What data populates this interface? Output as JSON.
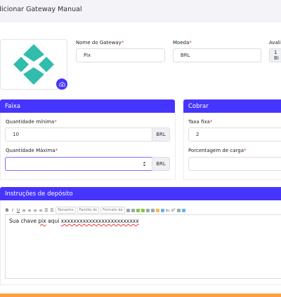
{
  "header": {
    "title": "dicionar Gateway Manual"
  },
  "logo": {
    "alt_name": "pix-logo"
  },
  "fields": {
    "gateway_name": {
      "label": "Nome do Gateway",
      "value": "Pix"
    },
    "currency": {
      "label": "Moeda",
      "value": "BRL"
    },
    "rate": {
      "label": "Avali",
      "value": "1 BI"
    }
  },
  "faixa": {
    "title": "Faixa",
    "min_label": "Quantidade mínima",
    "min_value": "10",
    "min_unit": "BRL",
    "max_label": "Quantidade Máxima",
    "max_value": "",
    "max_unit": "BRL"
  },
  "cobrar": {
    "title": "Cobrar",
    "fixed_label": "Taxa fixa",
    "fixed_value": "2",
    "percent_label": "Porcentagem de carga"
  },
  "instructions": {
    "title": "Instruções de depósito",
    "toolbar": {
      "size": "Tamanho",
      "font": "Família de",
      "format": "Formato da"
    },
    "content_start": "Sua chave ",
    "content_pix": "pix",
    "content_mid": " aqui ",
    "content_key": "xxxxxxxxxxxxxxxxxxxxxxxxx"
  },
  "colors": {
    "accent": "#4634ff",
    "bottom_bar": "#ff9f43",
    "required": "#e53935"
  }
}
